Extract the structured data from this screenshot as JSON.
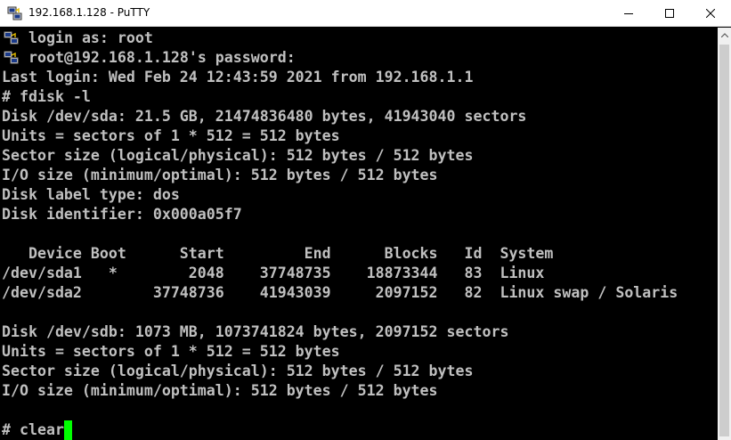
{
  "window": {
    "title": "192.168.1.128 - PuTTY",
    "icon": "putty-icon"
  },
  "controls": {
    "minimize_icon": "minimize-icon",
    "maximize_icon": "maximize-icon",
    "close_icon": "close-icon"
  },
  "terminal": {
    "lines": [
      "login as: root",
      "root@192.168.1.128's password:",
      "Last login: Wed Feb 24 12:43:59 2021 from 192.168.1.1",
      "# fdisk -l",
      "Disk /dev/sda: 21.5 GB, 21474836480 bytes, 41943040 sectors",
      "Units = sectors of 1 * 512 = 512 bytes",
      "Sector size (logical/physical): 512 bytes / 512 bytes",
      "I/O size (minimum/optimal): 512 bytes / 512 bytes",
      "Disk label type: dos",
      "Disk identifier: 0x000a05f7",
      "",
      "   Device Boot      Start         End      Blocks   Id  System",
      "/dev/sda1   *        2048    37748735    18873344   83  Linux",
      "/dev/sda2        37748736    41943039     2097152   82  Linux swap / Solaris",
      "",
      "Disk /dev/sdb: 1073 MB, 1073741824 bytes, 2097152 sectors",
      "Units = sectors of 1 * 512 = 512 bytes",
      "Sector size (logical/physical): 512 bytes / 512 bytes",
      "I/O size (minimum/optimal): 512 bytes / 512 bytes",
      "",
      "# clear"
    ],
    "colors": {
      "background": "#000000",
      "foreground": "#c0c0c0",
      "cursor": "#00ff00"
    }
  }
}
